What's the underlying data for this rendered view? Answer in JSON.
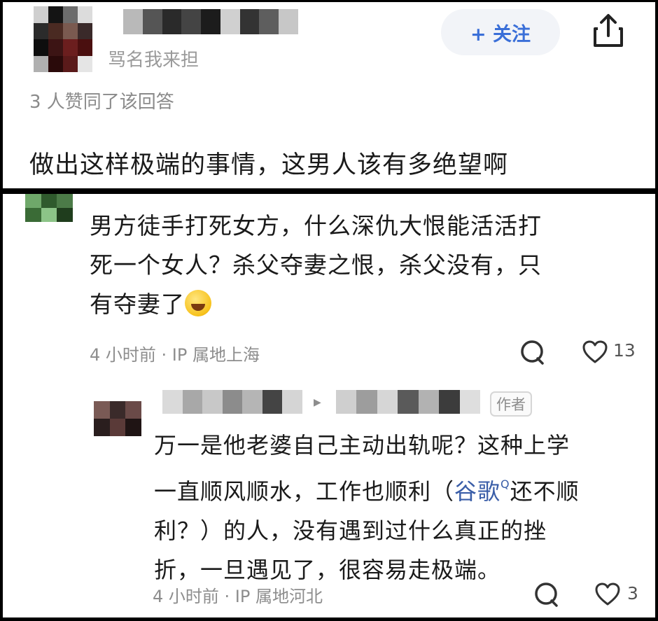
{
  "top": {
    "display_name": "骂名我来担",
    "follow_label": "+ 关注",
    "agree_text": "3 人赞同了该回答",
    "answer_text": "做出这样极端的事情，这男人该有多绝望啊"
  },
  "comment": {
    "text_line1": "男方徒手打死女方，什么深仇大恨能活活打",
    "text_line2": "死一个女人？杀父夺妻之恨，杀父没有，只",
    "text_line3": "有夺妻了",
    "meta": "4 小时前 · IP 属地上海",
    "like_count": "13"
  },
  "reply": {
    "author_tag": "作者",
    "text_line1": "万一是他老婆自己主动出轨呢？这种上学",
    "text_line2a": "一直顺风顺水，工作也顺利（",
    "mention": "谷歌",
    "mention_sup": "Q",
    "text_line2b": "还不顺",
    "text_line3": "利？）的人，没有遇到过什么真正的挫",
    "text_line4": "折，一旦遇见了，很容易走极端。",
    "meta": "4 小时前 · IP 属地河北",
    "like_count": "3"
  },
  "colors": {
    "follow_text": "#3a6fd8",
    "follow_bg": "#f2f4f8",
    "meta_text": "#8d8d8d"
  },
  "icons": [
    "share-icon",
    "comment-icon",
    "heart-icon",
    "laughing-emoji"
  ]
}
